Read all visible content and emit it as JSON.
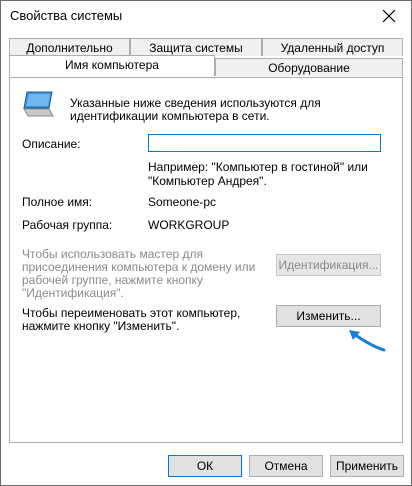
{
  "window": {
    "title": "Свойства системы"
  },
  "tabs_top": [
    "Дополнительно",
    "Защита системы",
    "Удаленный доступ"
  ],
  "tabs_bottom": [
    "Имя компьютера",
    "Оборудование"
  ],
  "panel": {
    "intro_line1": "Указанные ниже сведения используются для",
    "intro_line2": "идентификации компьютера в сети.",
    "description_label": "Описание:",
    "description_value": "",
    "example_line1": "Например: \"Компьютер в гостиной\" или",
    "example_line2": "\"Компьютер Андрея\".",
    "fullname_label": "Полное имя:",
    "fullname_value": "Someone-pc",
    "workgroup_label": "Рабочая группа:",
    "workgroup_value": "WORKGROUP",
    "wizard_line1": "Чтобы использовать мастер для",
    "wizard_line2": "присоединения компьютера к домену или",
    "wizard_line3": "рабочей группе, нажмите кнопку",
    "wizard_line4": "\"Идентификация\".",
    "identify_button": "Идентификация...",
    "rename_line1": "Чтобы переименовать этот компьютер,",
    "rename_line2": "нажмите кнопку \"Изменить\".",
    "change_button": "Изменить..."
  },
  "footer": {
    "ok": "ОК",
    "cancel": "Отмена",
    "apply": "Применить"
  },
  "colors": {
    "accent": "#0078d7",
    "arrow": "#1a7fd8"
  }
}
